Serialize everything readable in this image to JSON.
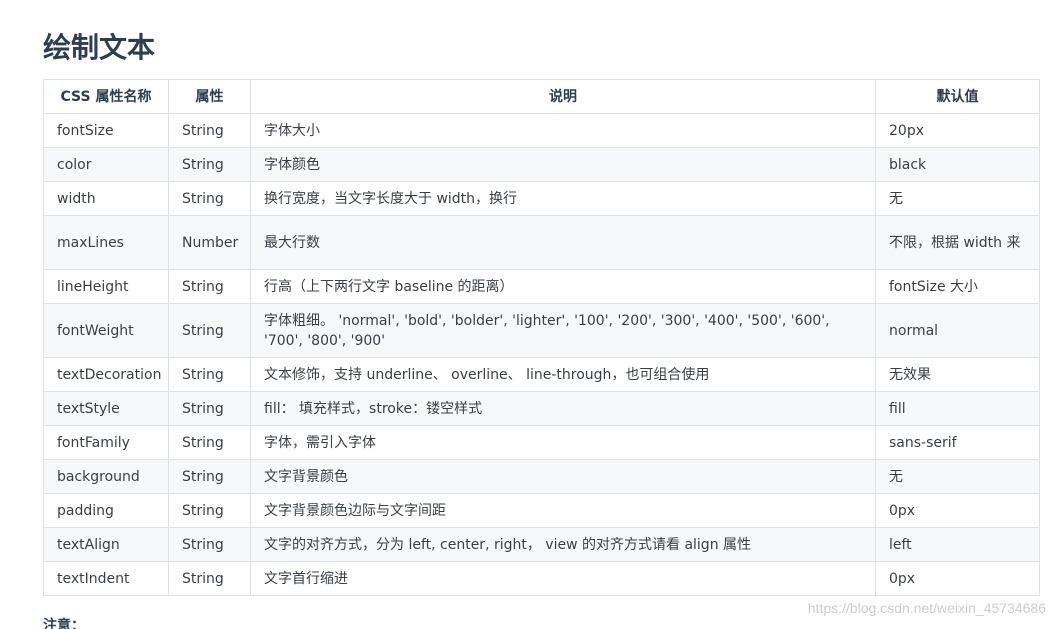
{
  "title": "绘制文本",
  "table": {
    "headers": [
      "CSS 属性名称",
      "属性",
      "说明",
      "默认值"
    ],
    "rows": [
      [
        "fontSize",
        "String",
        "字体大小",
        "20px"
      ],
      [
        "color",
        "String",
        "字体颜色",
        "black"
      ],
      [
        "width",
        "String",
        "换行宽度，当文字长度大于 width，换行",
        "无"
      ],
      [
        "maxLines",
        "Number",
        "最大行数",
        "不限，根据 width 来"
      ],
      [
        "lineHeight",
        "String",
        "行高（上下两行文字 baseline 的距离）",
        "fontSize 大小"
      ],
      [
        "fontWeight",
        "String",
        "字体粗细。 'normal', 'bold', 'bolder', 'lighter', '100', '200', '300', '400', '500', '600', '700', '800', '900'",
        "normal"
      ],
      [
        "textDecoration",
        "String",
        "文本修饰，支持 underline、 overline、 line-through，也可组合使用",
        "无效果"
      ],
      [
        "textStyle",
        "String",
        "fill： 填充样式，stroke：镂空样式",
        "fill"
      ],
      [
        "fontFamily",
        "String",
        "字体，需引入字体",
        "sans-serif"
      ],
      [
        "background",
        "String",
        "文字背景颜色",
        "无"
      ],
      [
        "padding",
        "String",
        "文字背景颜色边际与文字间距",
        "0px"
      ],
      [
        "textAlign",
        "String",
        "文字的对齐方式，分为 left, center, right， view 的对齐方式请看 align 属性",
        "left"
      ],
      [
        "textIndent",
        "String",
        "文字首行缩进",
        "0px"
      ]
    ]
  },
  "note_label": "注意：",
  "watermark": "https://blog.csdn.net/weixin_45734686",
  "colors": {
    "title": "#2c3e50",
    "text": "#3a3f47",
    "border": "#dfe2e5",
    "stripe": "#f6f8fa"
  }
}
